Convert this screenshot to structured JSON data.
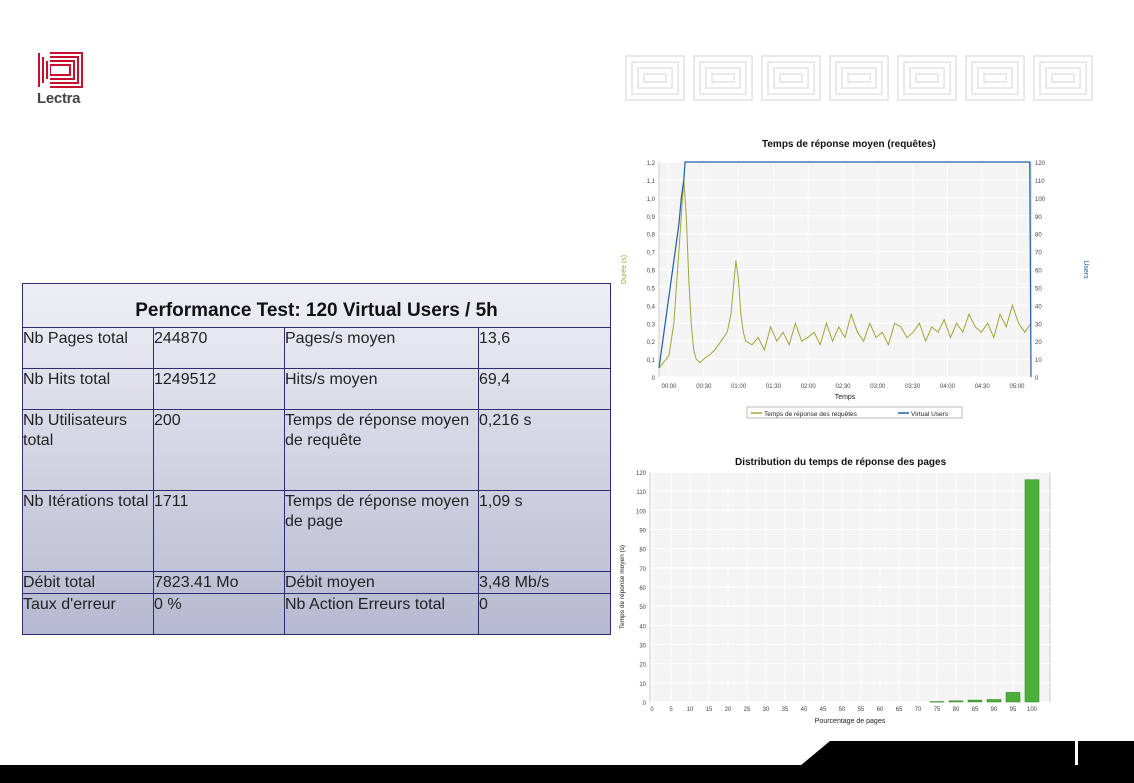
{
  "brand": {
    "name": "Lectra",
    "accent": "#c8102e"
  },
  "table": {
    "title": "Performance Test: 120 Virtual Users / 5h",
    "rows": [
      [
        "Nb Pages total",
        "244870",
        "Pages/s moyen",
        "13,6"
      ],
      [
        "Nb Hits total",
        "1249512",
        "Hits/s moyen",
        "69,4"
      ],
      [
        "Nb Utilisateurs total",
        "200",
        "Temps de réponse moyen de requête",
        "0,216 s"
      ],
      [
        "Nb Itérations total",
        "1711",
        "Temps de réponse moyen de page",
        "1,09 s"
      ],
      [
        "Débit total",
        "7823.41  Mo",
        "Débit moyen",
        "3,48  Mb/s"
      ],
      [
        "Taux d'erreur",
        "0 %",
        "Nb Action Erreurs total",
        "0"
      ]
    ]
  },
  "chart_data": [
    {
      "type": "line",
      "title": "Temps de réponse moyen (requêtes)",
      "xlabel": "Temps",
      "ylabel": "Durée (s)",
      "y2label": "Users",
      "x_ticks": [
        "00:00",
        "00:30",
        "01:00",
        "01:30",
        "02:00",
        "02:30",
        "03:00",
        "03:30",
        "04:00",
        "04:30",
        "05:00"
      ],
      "xlim": [
        0,
        300
      ],
      "ylim": [
        0,
        1.2
      ],
      "y_ticks": [
        "0",
        "0,1",
        "0,2",
        "0,3",
        "0,4",
        "0,5",
        "0,6",
        "0,7",
        "0,8",
        "0,9",
        "1,0",
        "1,1",
        "1,2"
      ],
      "y2lim": [
        0,
        120
      ],
      "y2_ticks": [
        "0",
        "10",
        "20",
        "30",
        "40",
        "50",
        "60",
        "70",
        "80",
        "90",
        "100",
        "110",
        "120"
      ],
      "grid": true,
      "legend": "bottom",
      "series": [
        {
          "name": "Temps de réponse des requêtes",
          "color": "#a3a33a",
          "axis": "left",
          "x": [
            0,
            8,
            12,
            15,
            18,
            20,
            22,
            24,
            26,
            28,
            30,
            33,
            36,
            40,
            45,
            50,
            55,
            58,
            60,
            62,
            64,
            66,
            68,
            70,
            75,
            80,
            85,
            90,
            95,
            100,
            105,
            110,
            115,
            120,
            125,
            130,
            135,
            140,
            145,
            150,
            155,
            160,
            165,
            170,
            175,
            180,
            185,
            190,
            195,
            200,
            205,
            210,
            215,
            220,
            225,
            230,
            235,
            240,
            245,
            250,
            255,
            260,
            265,
            270,
            275,
            280,
            285,
            290,
            295,
            300
          ],
          "y": [
            0.05,
            0.12,
            0.3,
            0.6,
            0.9,
            1.1,
            0.9,
            0.55,
            0.3,
            0.15,
            0.1,
            0.08,
            0.1,
            0.12,
            0.15,
            0.2,
            0.25,
            0.35,
            0.5,
            0.65,
            0.55,
            0.35,
            0.25,
            0.2,
            0.18,
            0.22,
            0.15,
            0.28,
            0.2,
            0.25,
            0.18,
            0.3,
            0.2,
            0.22,
            0.25,
            0.18,
            0.3,
            0.2,
            0.28,
            0.22,
            0.35,
            0.25,
            0.2,
            0.3,
            0.22,
            0.25,
            0.18,
            0.3,
            0.28,
            0.22,
            0.25,
            0.3,
            0.2,
            0.28,
            0.25,
            0.32,
            0.22,
            0.3,
            0.25,
            0.35,
            0.28,
            0.25,
            0.3,
            0.22,
            0.35,
            0.28,
            0.4,
            0.3,
            0.25,
            0.3
          ]
        },
        {
          "name": "Virtual Users",
          "color": "#1f5fa8",
          "axis": "right",
          "x": [
            0,
            2,
            4,
            6,
            8,
            10,
            12,
            14,
            16,
            18,
            20,
            21,
            299,
            300
          ],
          "y": [
            5,
            15,
            25,
            35,
            45,
            55,
            65,
            75,
            85,
            100,
            110,
            120,
            120,
            0
          ]
        }
      ]
    },
    {
      "type": "bar",
      "title": "Distribution du temps de réponse des pages",
      "xlabel": "Pourcentage de pages",
      "ylabel": "Temps de réponse moyen (s)",
      "categories": [
        "0",
        "5",
        "10",
        "15",
        "20",
        "25",
        "30",
        "35",
        "40",
        "45",
        "50",
        "55",
        "60",
        "65",
        "70",
        "75",
        "80",
        "85",
        "90",
        "95",
        "100"
      ],
      "values": [
        0,
        0,
        0,
        0,
        0,
        0,
        0,
        0,
        0,
        0,
        0,
        0,
        0,
        0,
        0,
        0.2,
        0.6,
        1.0,
        1.3,
        5,
        116
      ],
      "ylim": [
        0,
        120
      ],
      "y_ticks": [
        "0",
        "10",
        "20",
        "30",
        "40",
        "50",
        "60",
        "70",
        "80",
        "90",
        "100",
        "110",
        "120"
      ],
      "grid": true,
      "color": "#4caf38"
    }
  ]
}
